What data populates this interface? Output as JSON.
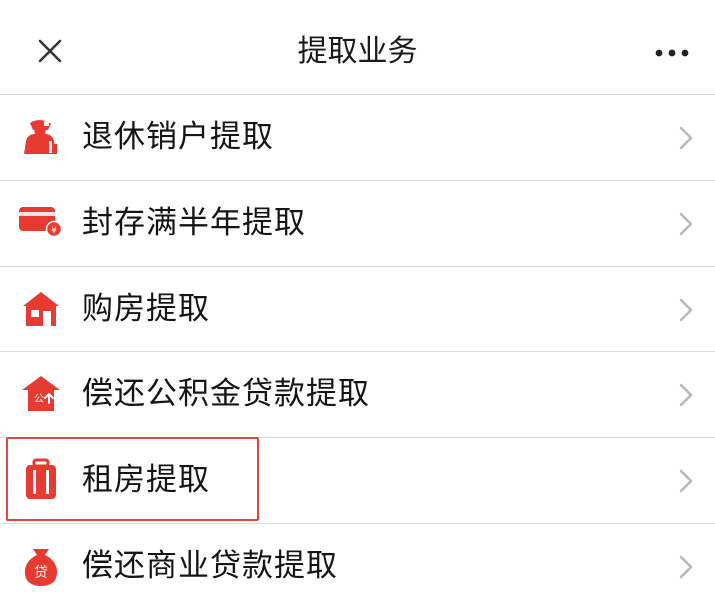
{
  "header": {
    "title": "提取业务",
    "close_icon": "close-icon",
    "more_icon": "more-horizontal-icon"
  },
  "list": {
    "items": [
      {
        "label": "退休销户提取",
        "icon": "retiree-icon"
      },
      {
        "label": "封存满半年提取",
        "icon": "card-yen-icon"
      },
      {
        "label": "购房提取",
        "icon": "house-icon"
      },
      {
        "label": "偿还公积金贷款提取",
        "icon": "fund-house-loan-icon"
      },
      {
        "label": "租房提取",
        "icon": "luggage-icon"
      },
      {
        "label": "偿还商业贷款提取",
        "icon": "loan-bag-icon"
      }
    ]
  },
  "colors": {
    "accent_red": "#e73b32",
    "highlight_border": "#d94c3b",
    "arrow_gray": "#b8b8b8",
    "divider": "#dcdcdc"
  }
}
